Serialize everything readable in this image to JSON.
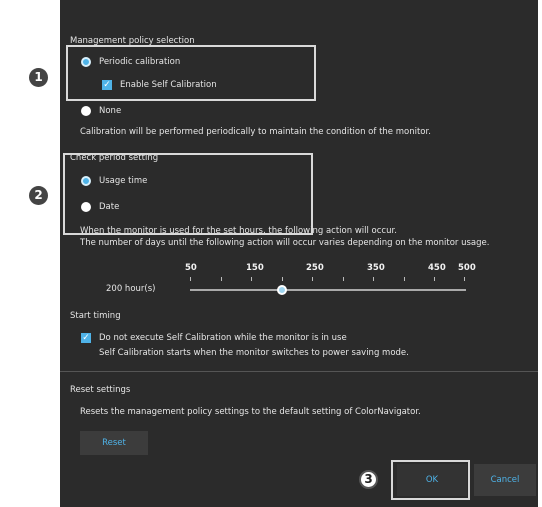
{
  "policy": {
    "section_title": "Management policy selection",
    "periodic_label": "Periodic calibration",
    "self_cal_label": "Enable Self Calibration",
    "none_label": "None",
    "description": "Calibration will be performed periodically to maintain the condition of the monitor."
  },
  "period": {
    "section_title": "Check period setting",
    "usage_time_label": "Usage time",
    "date_label": "Date",
    "line1": "When the monitor is used for the set hours, the following action will occur.",
    "line2": "The number of days until the following action will occur varies depending on the monitor usage.",
    "slider_value_label": "200 hour(s)",
    "slider_ticks": [
      "50",
      "150",
      "250",
      "350",
      "450",
      "500"
    ],
    "slider_value_hours": 200
  },
  "timing": {
    "section_title": "Start timing",
    "checkbox_label": "Do not execute Self Calibration while the monitor is in use",
    "note": "Self Calibration starts when the monitor switches to power saving mode."
  },
  "reset": {
    "section_title": "Reset settings",
    "description": "Resets the management policy settings to the default setting of ColorNavigator.",
    "button_label": "Reset"
  },
  "footer": {
    "ok_label": "OK",
    "cancel_label": "Cancel"
  },
  "markers": [
    "1",
    "2",
    "3"
  ],
  "colors": {
    "accent": "#4fb3e8",
    "panel": "#2b2b2b"
  }
}
